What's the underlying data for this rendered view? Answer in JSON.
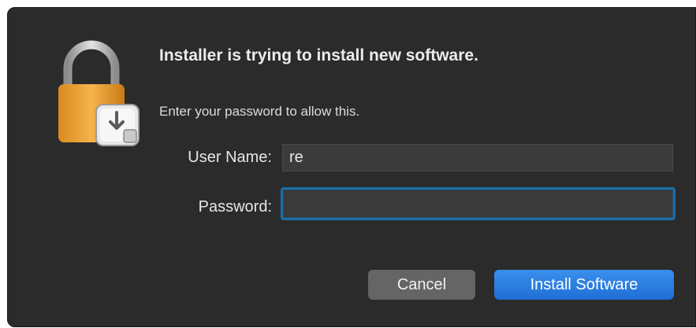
{
  "dialog": {
    "title": "Installer is trying to install new software.",
    "subtitle": "Enter your password to allow this."
  },
  "form": {
    "username_label": "User Name:",
    "username_value": "re",
    "password_label": "Password:",
    "password_value": ""
  },
  "buttons": {
    "cancel_label": "Cancel",
    "install_label": "Install Software"
  },
  "icons": {
    "lock": "lock-icon",
    "installer": "installer-package-icon"
  },
  "colors": {
    "background": "#2b2b2b",
    "accent": "#1f6fd6",
    "focus_ring": "#1b6ea8",
    "lock_body": "#f0a33a"
  }
}
